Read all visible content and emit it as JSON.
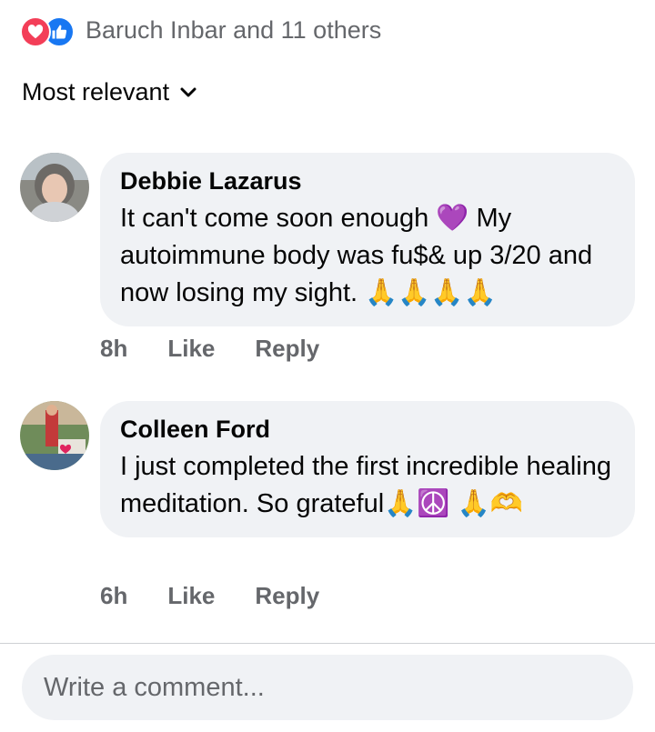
{
  "reactions": {
    "text": "Baruch Inbar and 11 others",
    "icons": [
      "heart-reaction",
      "like-reaction"
    ],
    "colors": {
      "heart": "#f33e58",
      "like": "#1877f2"
    }
  },
  "sort": {
    "label": "Most relevant"
  },
  "comments": [
    {
      "author": "Debbie Lazarus",
      "text": "It can't come soon enough 💜 My autoimmune body was fu$& up 3/20 and now losing my sight. 🙏🙏🙏🙏",
      "time": "8h",
      "like_label": "Like",
      "reply_label": "Reply"
    },
    {
      "author": "Colleen Ford",
      "text": "I just completed the first incredible healing meditation. So grateful🙏☮️ 🙏🫶",
      "time": "6h",
      "like_label": "Like",
      "reply_label": "Reply"
    }
  ],
  "composer": {
    "placeholder": "Write a comment..."
  }
}
